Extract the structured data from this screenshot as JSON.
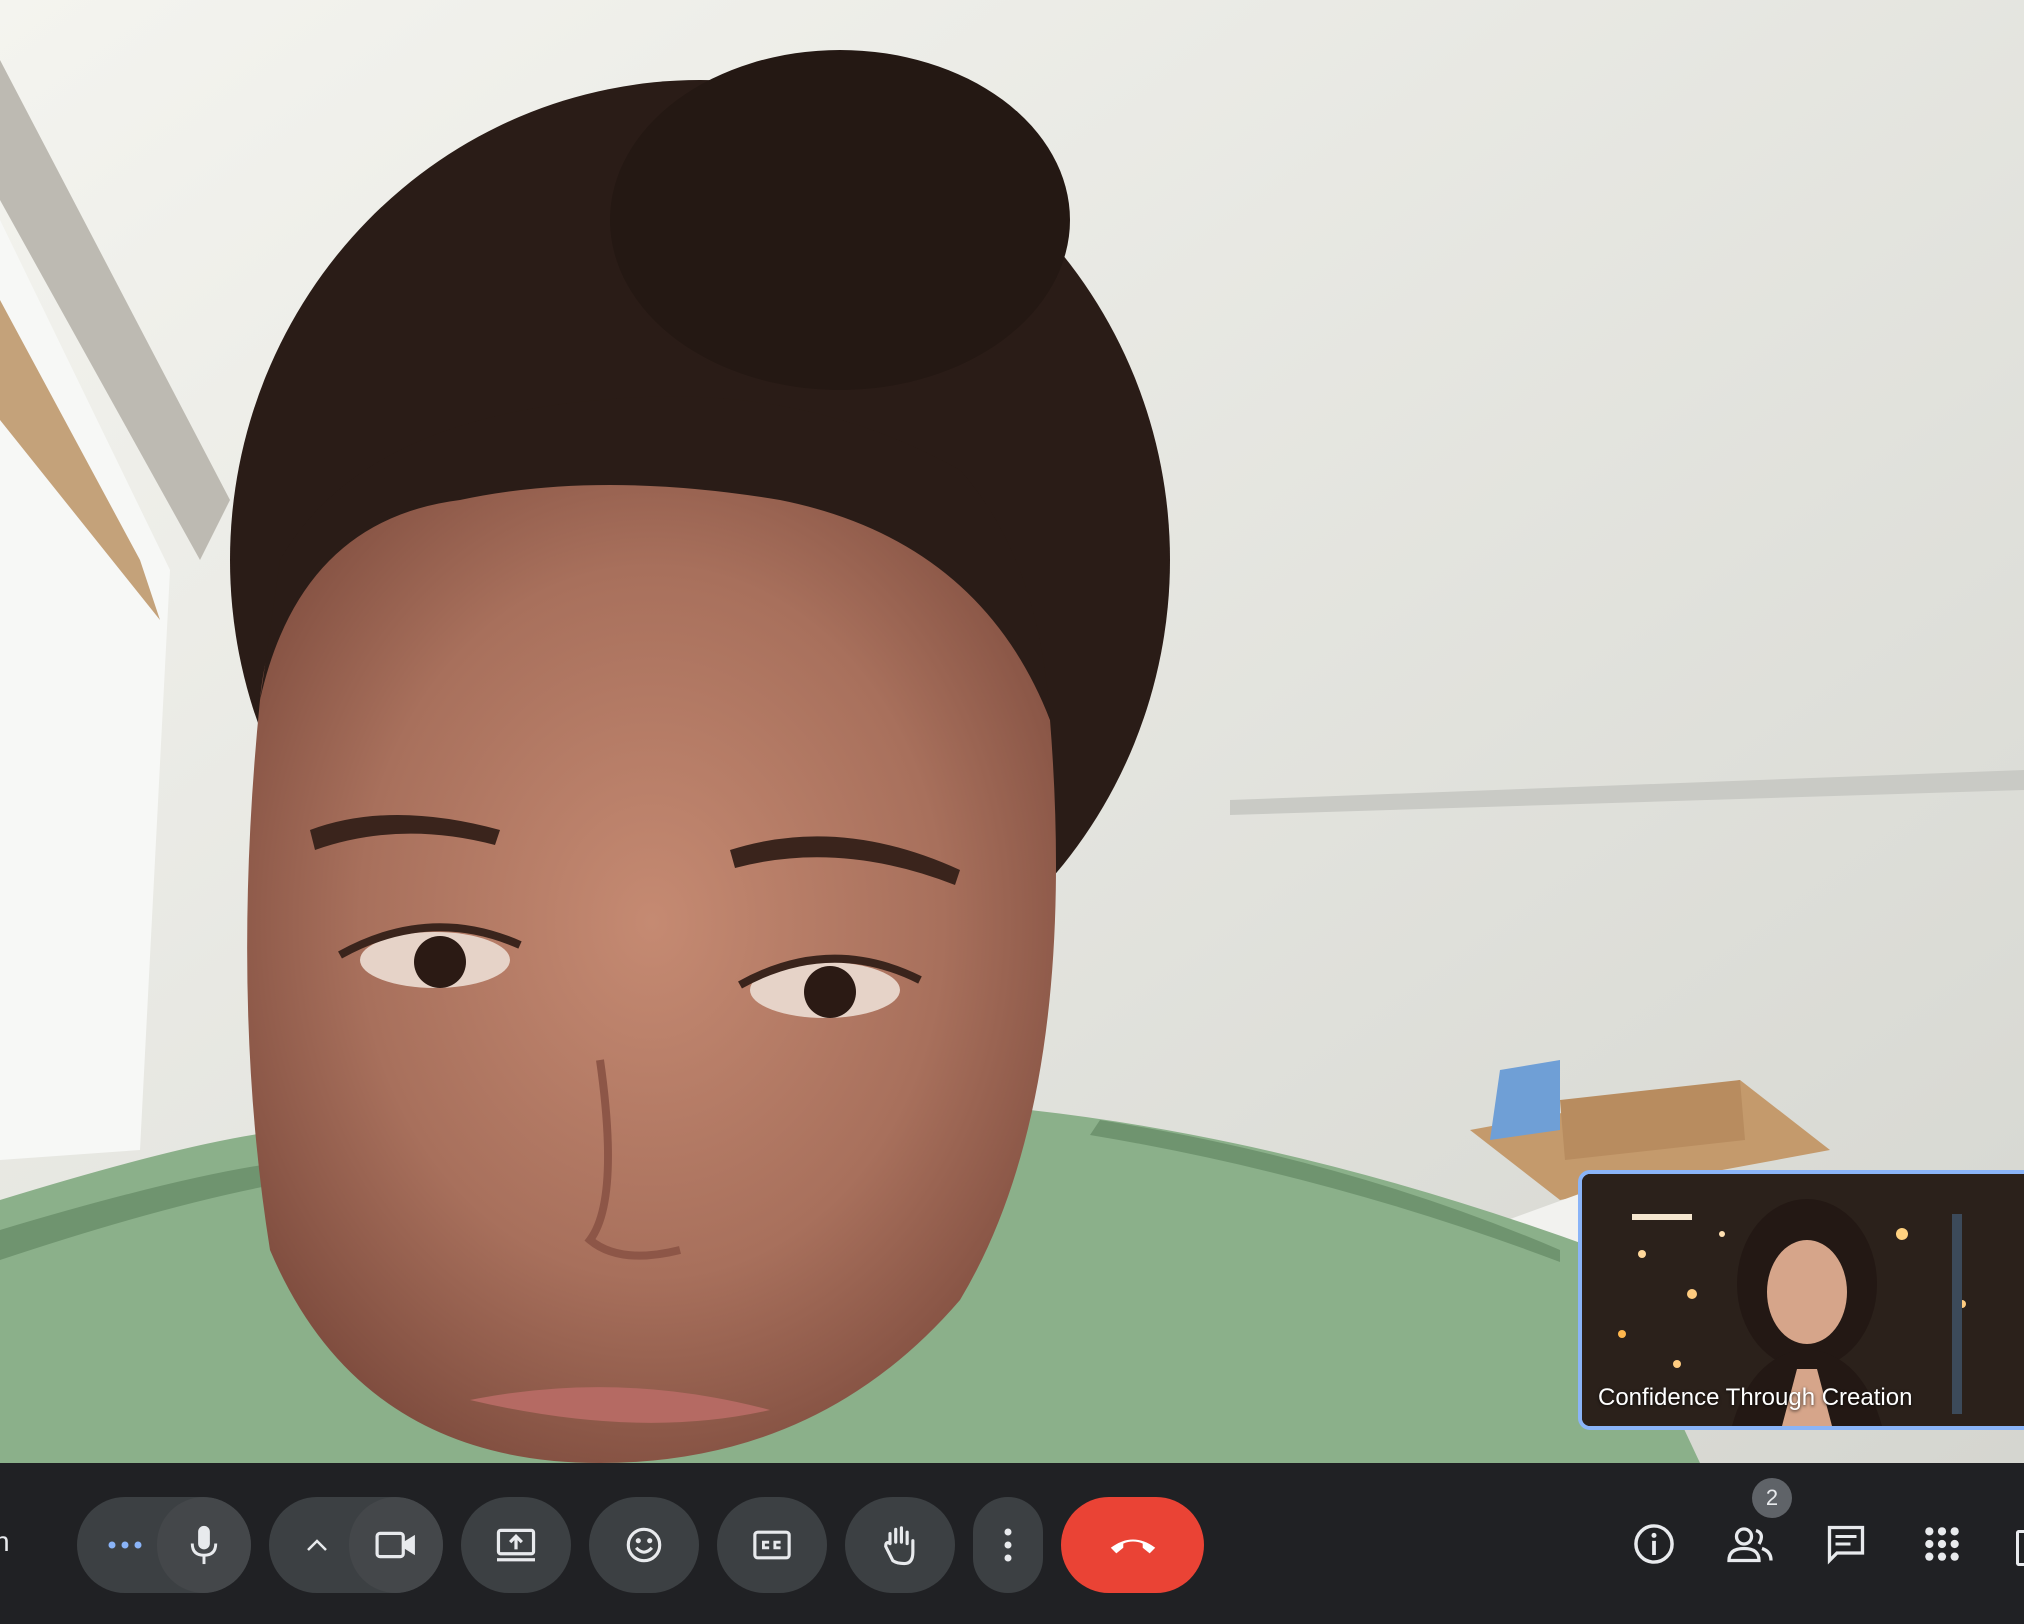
{
  "call": {
    "meeting_code_fragment": "n"
  },
  "self_view": {
    "name": "Confidence Through Creation"
  },
  "participants": {
    "count": "2"
  },
  "controls": {
    "more_options_aria": "More options",
    "mic_aria": "Turn off microphone",
    "camera_options_aria": "Video options",
    "camera_aria": "Turn off camera",
    "present_aria": "Present now",
    "emoji_aria": "Send a reaction",
    "captions_aria": "Turn on captions",
    "raise_hand_aria": "Raise hand",
    "more_aria": "More options",
    "leave_aria": "Leave call"
  },
  "side_controls": {
    "info_aria": "Meeting details",
    "people_aria": "Show everyone",
    "chat_aria": "Chat with everyone",
    "activities_aria": "Activities"
  },
  "colors": {
    "toolbar_bg": "#202124",
    "button_bg": "#3c4043",
    "end_call": "#ea4335",
    "self_border": "#8ab4f8"
  }
}
